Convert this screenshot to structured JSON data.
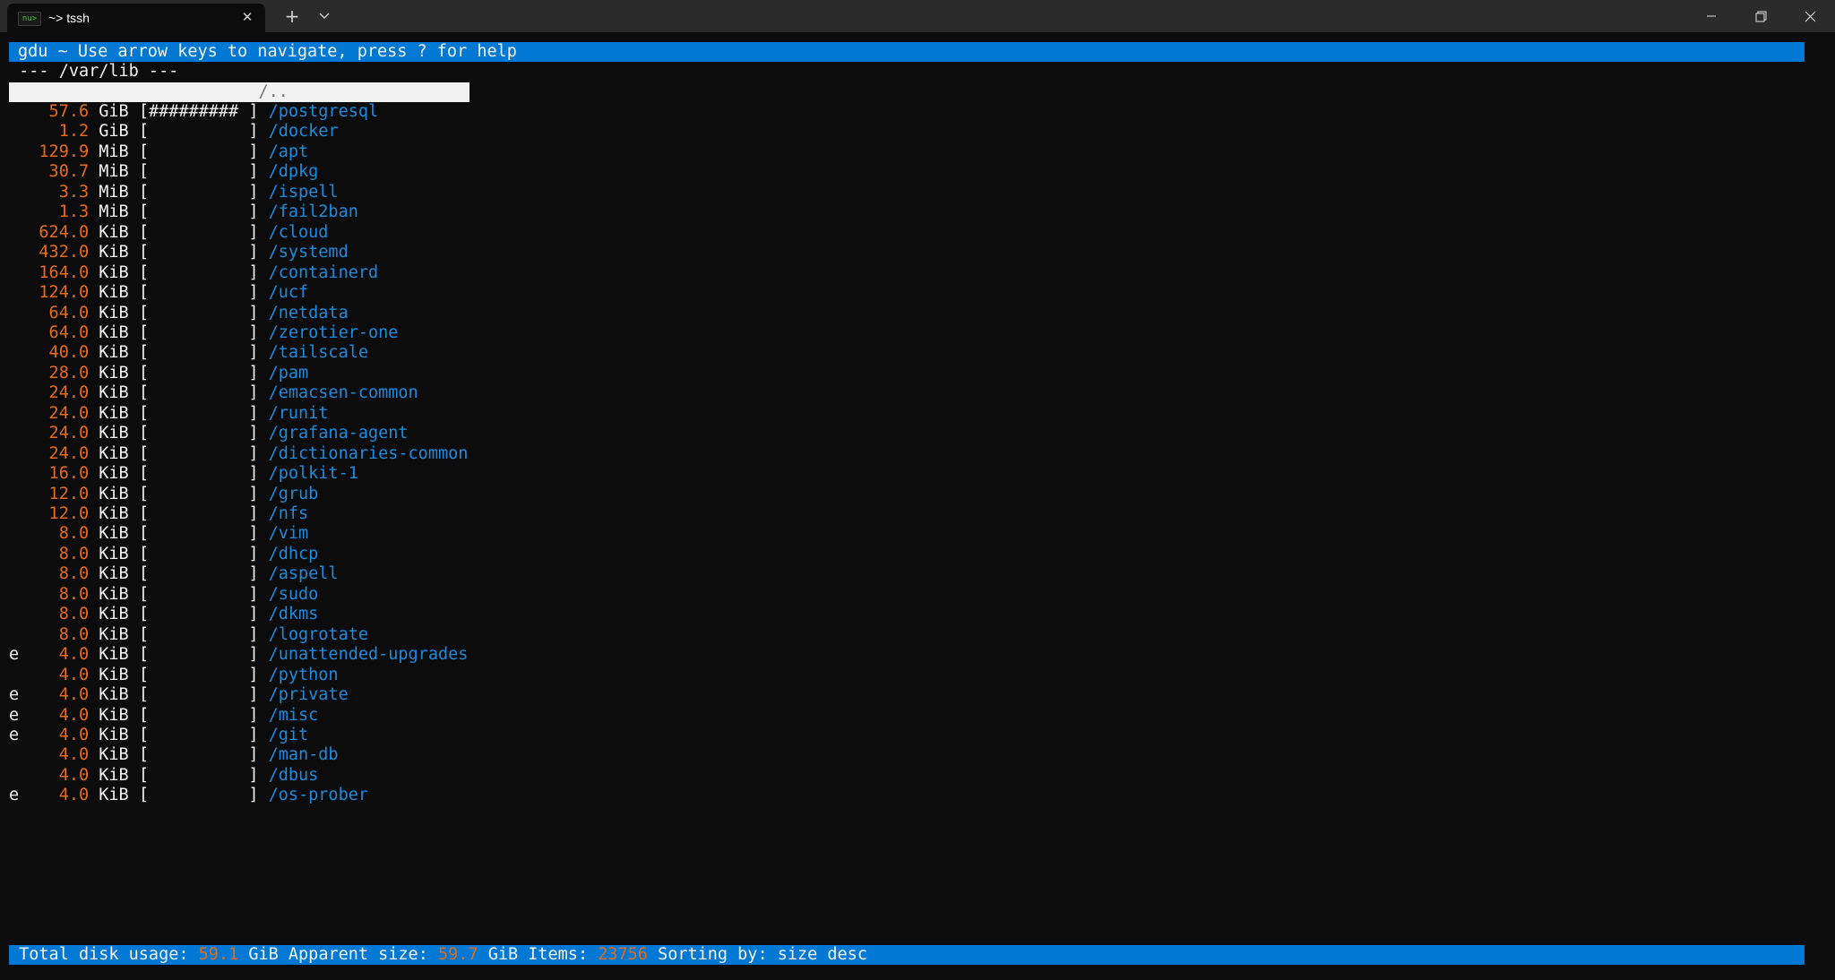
{
  "window": {
    "tab_icon_text": "nu>",
    "tab_title": "~> tssh",
    "tab_close_glyph": "✕",
    "new_tab_glyph": "+",
    "icons": [
      "terminal-icon",
      "close-icon",
      "plus-icon",
      "chevron-down-icon",
      "minimize-icon",
      "maximize-icon",
      "close-window-icon"
    ]
  },
  "gdu": {
    "header": "gdu ~ Use arrow keys to navigate, press ? for help",
    "path_line": "--- /var/lib ---",
    "parent_row": "                         /..",
    "rows": [
      {
        "flag": " ",
        "size": "57.6",
        "unit": "GiB",
        "bar": "[######### ]",
        "name": "/postgresql"
      },
      {
        "flag": " ",
        "size": "1.2",
        "unit": "GiB",
        "bar": "[          ]",
        "name": "/docker"
      },
      {
        "flag": " ",
        "size": "129.9",
        "unit": "MiB",
        "bar": "[          ]",
        "name": "/apt"
      },
      {
        "flag": " ",
        "size": "30.7",
        "unit": "MiB",
        "bar": "[          ]",
        "name": "/dpkg"
      },
      {
        "flag": " ",
        "size": "3.3",
        "unit": "MiB",
        "bar": "[          ]",
        "name": "/ispell"
      },
      {
        "flag": " ",
        "size": "1.3",
        "unit": "MiB",
        "bar": "[          ]",
        "name": "/fail2ban"
      },
      {
        "flag": " ",
        "size": "624.0",
        "unit": "KiB",
        "bar": "[          ]",
        "name": "/cloud"
      },
      {
        "flag": " ",
        "size": "432.0",
        "unit": "KiB",
        "bar": "[          ]",
        "name": "/systemd"
      },
      {
        "flag": " ",
        "size": "164.0",
        "unit": "KiB",
        "bar": "[          ]",
        "name": "/containerd"
      },
      {
        "flag": " ",
        "size": "124.0",
        "unit": "KiB",
        "bar": "[          ]",
        "name": "/ucf"
      },
      {
        "flag": " ",
        "size": "64.0",
        "unit": "KiB",
        "bar": "[          ]",
        "name": "/netdata"
      },
      {
        "flag": " ",
        "size": "64.0",
        "unit": "KiB",
        "bar": "[          ]",
        "name": "/zerotier-one"
      },
      {
        "flag": " ",
        "size": "40.0",
        "unit": "KiB",
        "bar": "[          ]",
        "name": "/tailscale"
      },
      {
        "flag": " ",
        "size": "28.0",
        "unit": "KiB",
        "bar": "[          ]",
        "name": "/pam"
      },
      {
        "flag": " ",
        "size": "24.0",
        "unit": "KiB",
        "bar": "[          ]",
        "name": "/emacsen-common"
      },
      {
        "flag": " ",
        "size": "24.0",
        "unit": "KiB",
        "bar": "[          ]",
        "name": "/runit"
      },
      {
        "flag": " ",
        "size": "24.0",
        "unit": "KiB",
        "bar": "[          ]",
        "name": "/grafana-agent"
      },
      {
        "flag": " ",
        "size": "24.0",
        "unit": "KiB",
        "bar": "[          ]",
        "name": "/dictionaries-common"
      },
      {
        "flag": " ",
        "size": "16.0",
        "unit": "KiB",
        "bar": "[          ]",
        "name": "/polkit-1"
      },
      {
        "flag": " ",
        "size": "12.0",
        "unit": "KiB",
        "bar": "[          ]",
        "name": "/grub"
      },
      {
        "flag": " ",
        "size": "12.0",
        "unit": "KiB",
        "bar": "[          ]",
        "name": "/nfs"
      },
      {
        "flag": " ",
        "size": "8.0",
        "unit": "KiB",
        "bar": "[          ]",
        "name": "/vim"
      },
      {
        "flag": " ",
        "size": "8.0",
        "unit": "KiB",
        "bar": "[          ]",
        "name": "/dhcp"
      },
      {
        "flag": " ",
        "size": "8.0",
        "unit": "KiB",
        "bar": "[          ]",
        "name": "/aspell"
      },
      {
        "flag": " ",
        "size": "8.0",
        "unit": "KiB",
        "bar": "[          ]",
        "name": "/sudo"
      },
      {
        "flag": " ",
        "size": "8.0",
        "unit": "KiB",
        "bar": "[          ]",
        "name": "/dkms"
      },
      {
        "flag": " ",
        "size": "8.0",
        "unit": "KiB",
        "bar": "[          ]",
        "name": "/logrotate"
      },
      {
        "flag": "e",
        "size": "4.0",
        "unit": "KiB",
        "bar": "[          ]",
        "name": "/unattended-upgrades"
      },
      {
        "flag": " ",
        "size": "4.0",
        "unit": "KiB",
        "bar": "[          ]",
        "name": "/python"
      },
      {
        "flag": "e",
        "size": "4.0",
        "unit": "KiB",
        "bar": "[          ]",
        "name": "/private"
      },
      {
        "flag": "e",
        "size": "4.0",
        "unit": "KiB",
        "bar": "[          ]",
        "name": "/misc"
      },
      {
        "flag": "e",
        "size": "4.0",
        "unit": "KiB",
        "bar": "[          ]",
        "name": "/git"
      },
      {
        "flag": " ",
        "size": "4.0",
        "unit": "KiB",
        "bar": "[          ]",
        "name": "/man-db"
      },
      {
        "flag": " ",
        "size": "4.0",
        "unit": "KiB",
        "bar": "[          ]",
        "name": "/dbus"
      },
      {
        "flag": "e",
        "size": "4.0",
        "unit": "KiB",
        "bar": "[          ]",
        "name": "/os-prober"
      }
    ],
    "footer": {
      "total_label": "Total disk usage:",
      "total_value": "59.1",
      "total_unit": "GiB",
      "apparent_label": "Apparent size:",
      "apparent_value": "59.7",
      "apparent_unit": "GiB",
      "items_label": "Items:",
      "items_value": "23756",
      "sort_label": "Sorting by: size desc"
    }
  },
  "colors": {
    "terminal_bg": "#0c0c0c",
    "bar_blue": "#0078d4",
    "size_orange": "#e76b18",
    "dir_blue": "#1c8ce0",
    "text_white": "#f2f2f2"
  }
}
